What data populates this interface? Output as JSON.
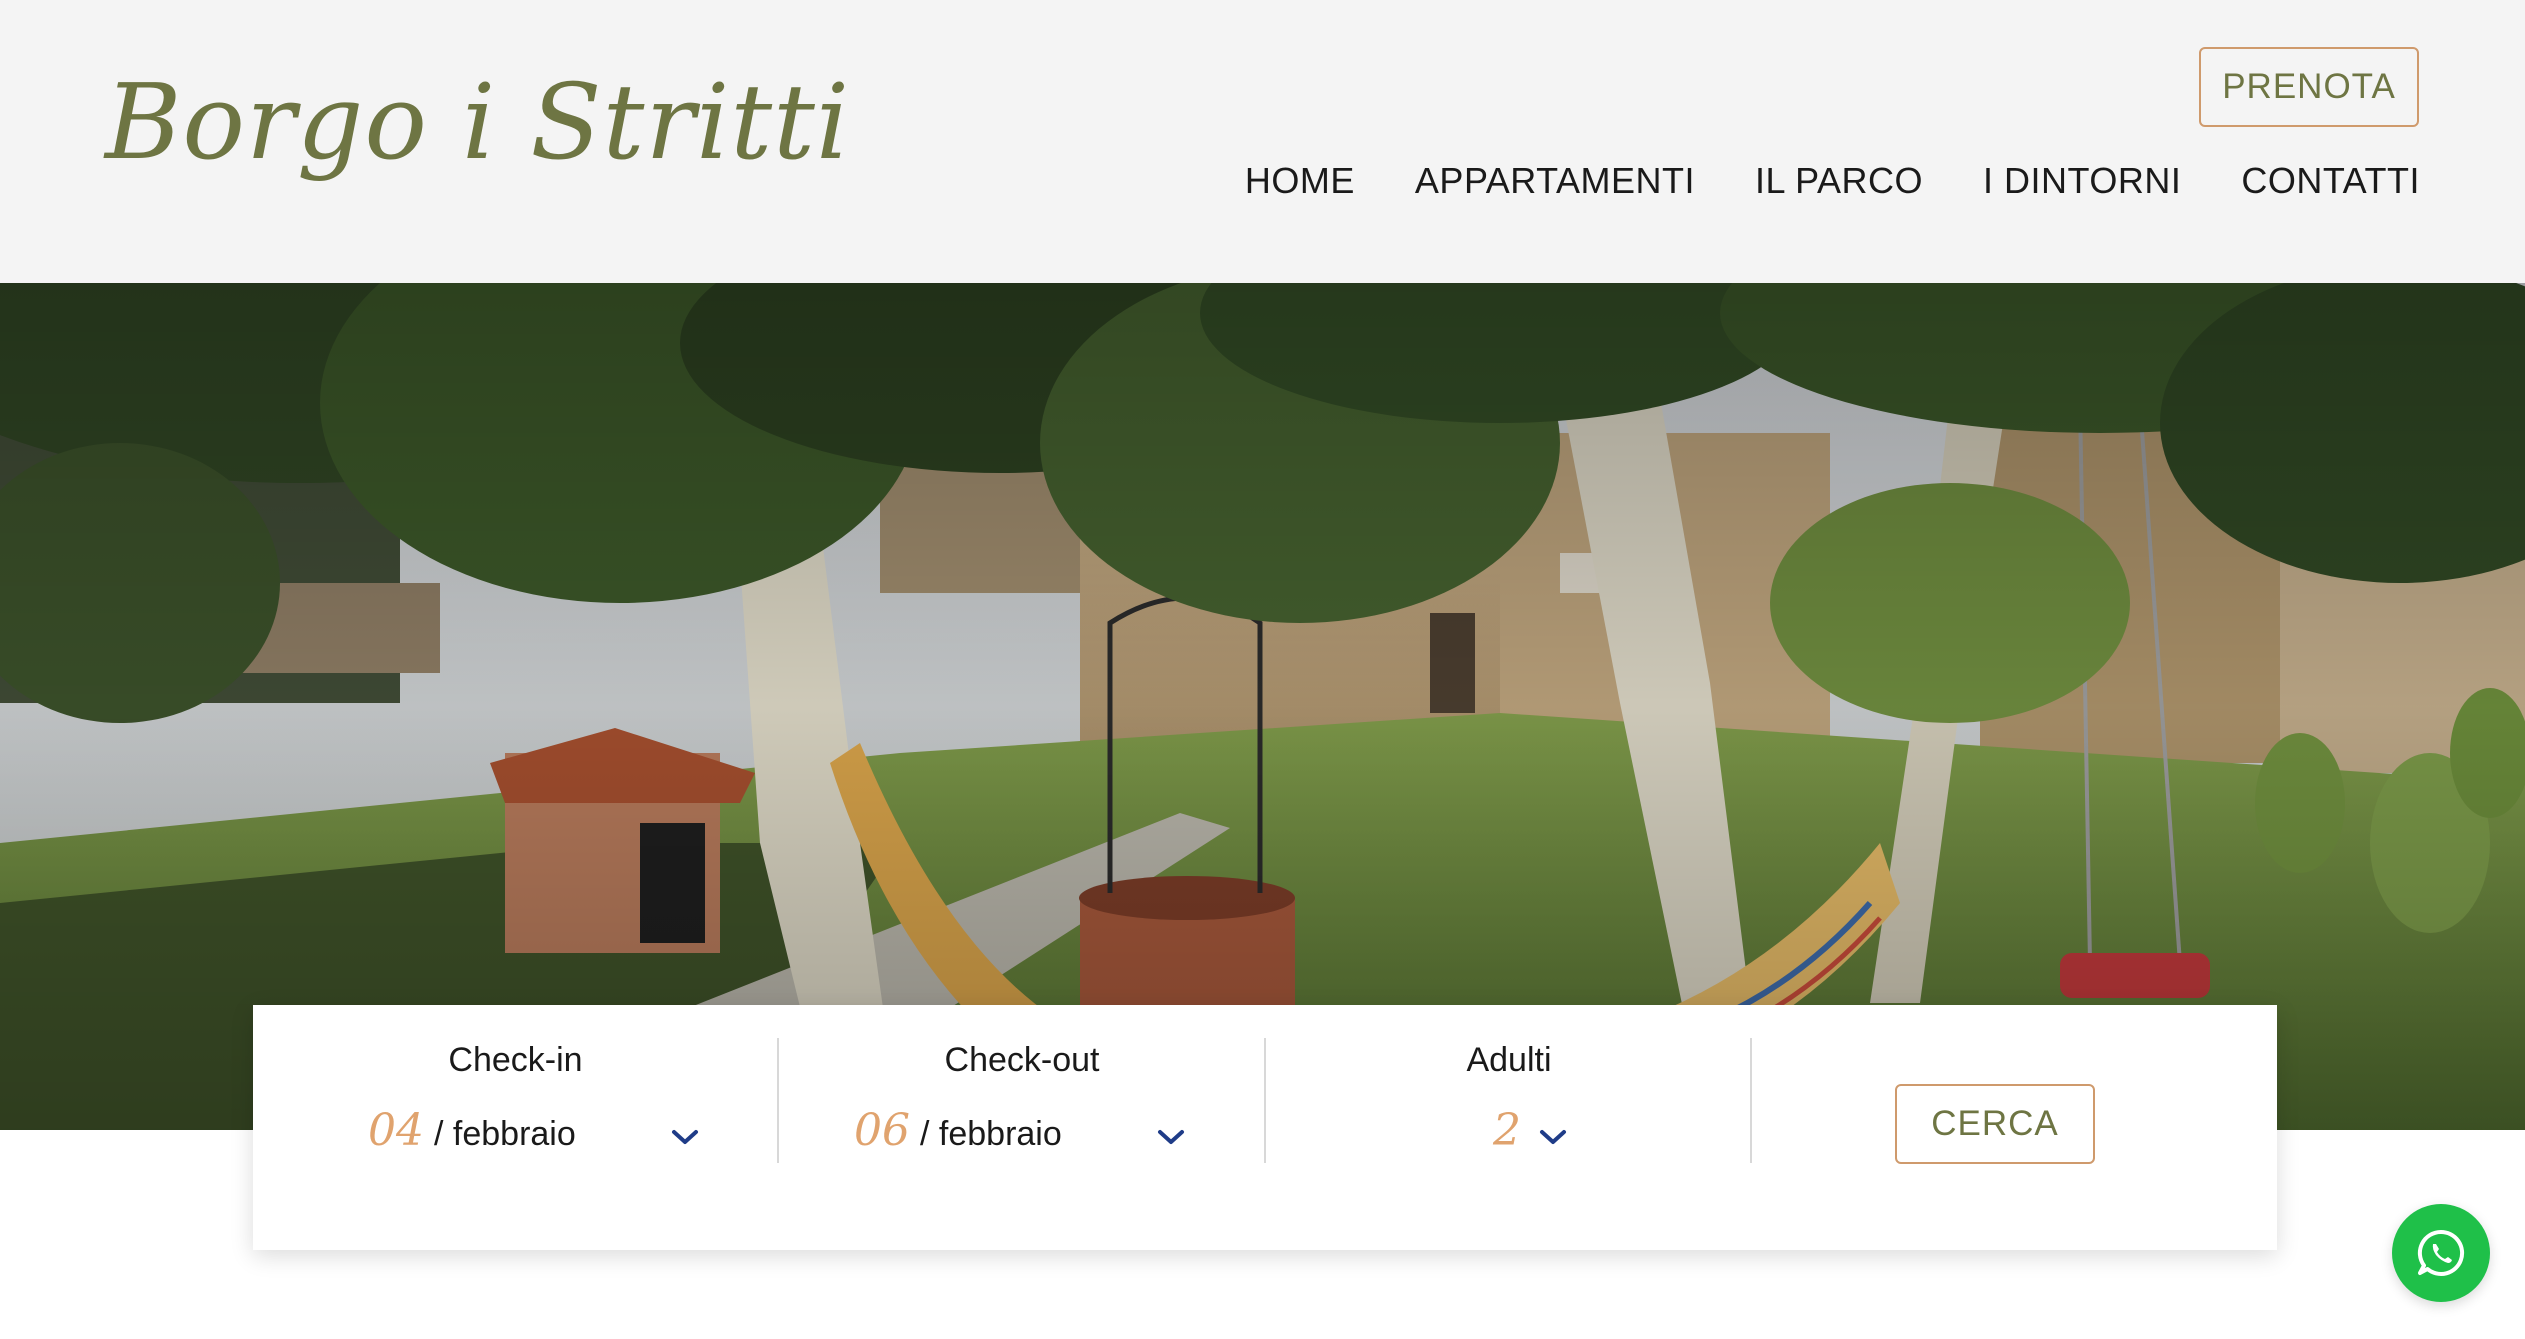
{
  "brand": {
    "logo_text": "Borgo i Stritti"
  },
  "header": {
    "book_button": "PRENOTA",
    "nav": [
      "HOME",
      "APPARTAMENTI",
      "IL PARCO",
      "I DINTORNI",
      "CONTATTI"
    ]
  },
  "booking": {
    "checkin": {
      "label": "Check-in",
      "day": "04",
      "month": "/ febbraio"
    },
    "checkout": {
      "label": "Check-out",
      "day": "06",
      "month": "/ febbraio"
    },
    "adults": {
      "label": "Adulti",
      "value": "2"
    },
    "search_button": "CERCA"
  },
  "colors": {
    "accent_olive": "#6e7543",
    "accent_orange": "#cf9a6c",
    "whatsapp_green": "#1fc049",
    "chevron_blue": "#1f3c88"
  },
  "icons": [
    "chevron-down-icon",
    "whatsapp-icon"
  ]
}
